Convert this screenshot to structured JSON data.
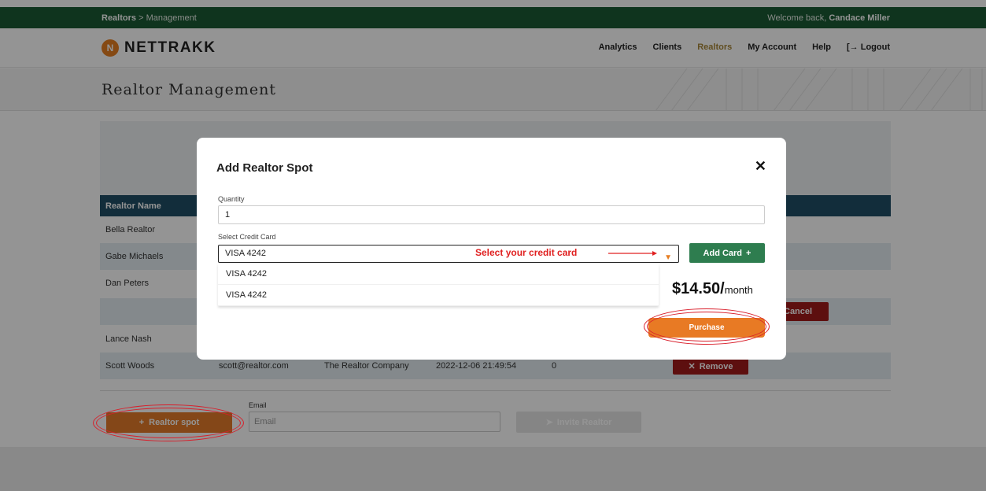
{
  "topbar": {
    "crumb_main": "Realtors",
    "crumb_sep": " > ",
    "crumb_sub": "Management",
    "welcome": "Welcome back, ",
    "user": "Candace Miller"
  },
  "header": {
    "logo_letter": "N",
    "logo_text": "NETTRAKK",
    "nav": [
      "Analytics",
      "Clients",
      "Realtors",
      "My Account",
      "Help",
      "[→ Logout"
    ]
  },
  "page": {
    "title": "Realtor Management"
  },
  "table": {
    "header": "Realtor Name",
    "rows": [
      {
        "name": "Bella Realtor"
      },
      {
        "name": "Gabe Michaels"
      },
      {
        "name": "Dan Peters"
      },
      {
        "name": ""
      },
      {
        "name": "Lance Nash"
      },
      {
        "name": "Scott Woods",
        "email": "scott@realtor.com",
        "company": "The Realtor Company",
        "date": "2022-12-06 21:49:54",
        "count": "0",
        "action": "Remove"
      }
    ],
    "cancel_label": "Cancel"
  },
  "footer_form": {
    "add_spot_label": "Realtor spot",
    "email_label": "Email",
    "email_placeholder": "Email",
    "invite_label": "Invite Realtor"
  },
  "modal": {
    "title": "Add Realtor Spot",
    "quantity_label": "Quantity",
    "quantity_value": "1",
    "card_label": "Select Credit Card",
    "card_selected": "VISA 4242",
    "card_options": [
      "VISA 4242",
      "VISA 4242"
    ],
    "add_card_label": "Add Card",
    "price": "$14.50/",
    "price_unit": "month",
    "purchase_label": "Purchase",
    "annotation": "Select your credit card"
  },
  "colors": {
    "brand_green": "#1b5a35",
    "accent_orange": "#e47b2a",
    "table_head": "#1f4f66",
    "danger": "#a01a1a",
    "annotation_red": "#e02020"
  }
}
